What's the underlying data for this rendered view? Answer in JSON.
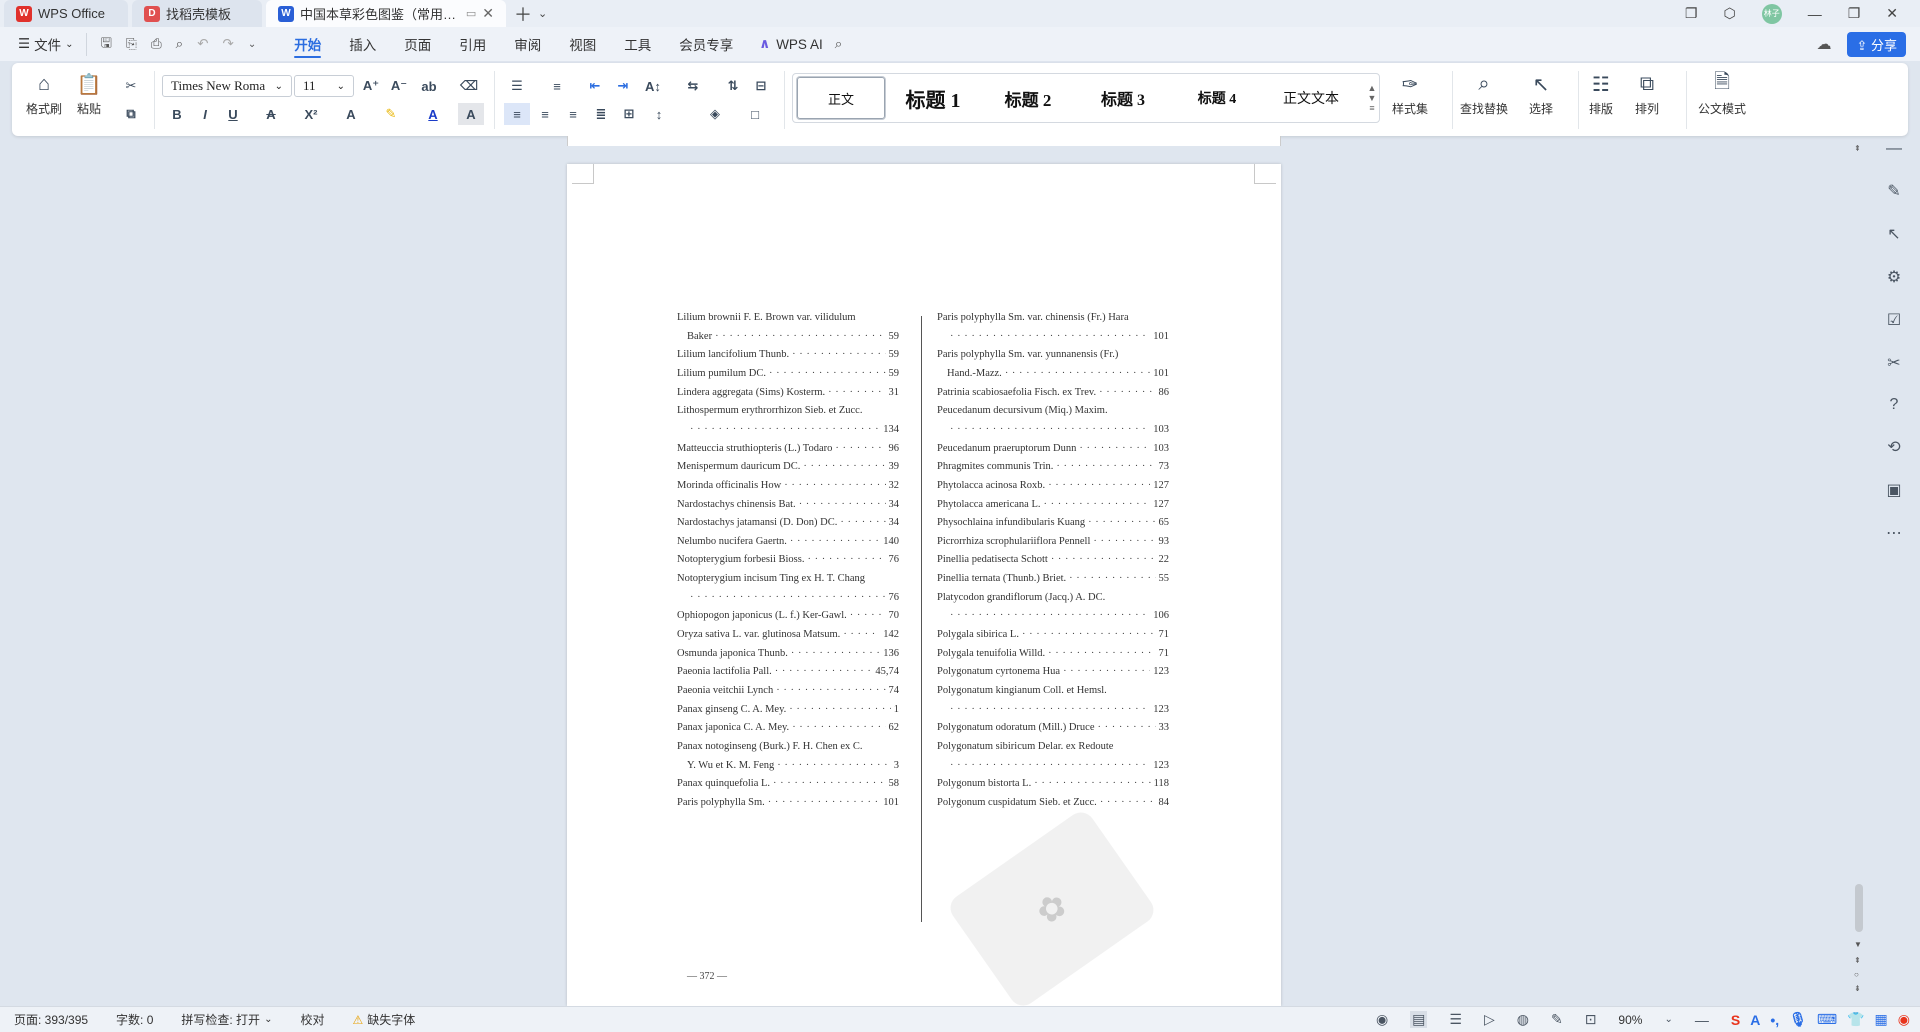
{
  "titlebar": {
    "tabs": [
      {
        "label": "WPS Office",
        "icon": "wps-logo-icon"
      },
      {
        "label": "找稻壳模板",
        "icon": "docer-icon"
      },
      {
        "label": "中国本草彩色图鉴（常用中药篇）",
        "icon": "word-doc-icon"
      }
    ],
    "avatar_text": "林子"
  },
  "menubar": {
    "file_label": "文件",
    "menus": [
      "开始",
      "插入",
      "页面",
      "引用",
      "审阅",
      "视图",
      "工具",
      "会员专享"
    ],
    "active_menu": "开始",
    "wps_ai_label": "WPS AI",
    "share_label": "分享"
  },
  "ribbon": {
    "format_painter": "格式刷",
    "paste": "粘贴",
    "font_name": "Times New Roma",
    "font_size": "11",
    "styles": [
      "正文",
      "标题 1",
      "标题 2",
      "标题 3",
      "标题 4",
      "正文文本"
    ],
    "style_set": "样式集",
    "find_replace": "查找替换",
    "select": "选择",
    "layout": "排版",
    "arrange": "排列",
    "official_mode": "公文模式"
  },
  "document": {
    "left_column": [
      {
        "name": "Lilium brownii F. E. Brown var. vilidulum",
        "page": ""
      },
      {
        "name": "Baker",
        "page": "59",
        "indent": true
      },
      {
        "name": "Lilium lancifolium Thunb.",
        "page": "59"
      },
      {
        "name": "Lilium pumilum DC.",
        "page": "59"
      },
      {
        "name": "Lindera aggregata (Sims) Kosterm.",
        "page": "31"
      },
      {
        "name": "Lithospermum erythrorrhizon Sieb. et Zucc.",
        "page": ""
      },
      {
        "name": "",
        "page": "134",
        "indent": true
      },
      {
        "name": "Matteuccia struthiopteris (L.) Todaro",
        "page": "96"
      },
      {
        "name": "Menispermum dauricum DC.",
        "page": "39"
      },
      {
        "name": "Morinda officinalis How",
        "page": "32"
      },
      {
        "name": "Nardostachys chinensis Bat.",
        "page": "34"
      },
      {
        "name": "Nardostachys jatamansi (D. Don) DC.",
        "page": "34"
      },
      {
        "name": "Nelumbo nucifera Gaertn.",
        "page": "140"
      },
      {
        "name": "Notopterygium forbesii Bioss.",
        "page": "76"
      },
      {
        "name": "Notopterygium incisum Ting ex H. T. Chang",
        "page": ""
      },
      {
        "name": "",
        "page": "76",
        "indent": true
      },
      {
        "name": "Ophiopogon japonicus (L. f.) Ker-Gawl.",
        "page": "70"
      },
      {
        "name": "Oryza sativa L. var. glutinosa Matsum.",
        "page": "142"
      },
      {
        "name": "Osmunda japonica Thunb.",
        "page": "136"
      },
      {
        "name": "Paeonia lactifolia Pall.",
        "page": "45,74"
      },
      {
        "name": "Paeonia veitchii Lynch",
        "page": "74"
      },
      {
        "name": "Panax ginseng C. A. Mey.",
        "page": "1"
      },
      {
        "name": "Panax japonica C. A. Mey.",
        "page": "62"
      },
      {
        "name": "Panax notoginseng (Burk.) F. H. Chen ex C.",
        "page": ""
      },
      {
        "name": "Y. Wu et K. M. Feng",
        "page": "3",
        "indent": true
      },
      {
        "name": "Panax quinquefolia L.",
        "page": "58"
      },
      {
        "name": "Paris polyphylla Sm.",
        "page": "101"
      }
    ],
    "right_column": [
      {
        "name": "Paris polyphylla Sm. var. chinensis (Fr.) Hara",
        "page": ""
      },
      {
        "name": "",
        "page": "101",
        "indent": true
      },
      {
        "name": "Paris polyphylla Sm. var. yunnanensis (Fr.)",
        "page": ""
      },
      {
        "name": "Hand.-Mazz.",
        "page": "101",
        "indent": true
      },
      {
        "name": "Patrinia scabiosaefolia Fisch. ex Trev.",
        "page": "86"
      },
      {
        "name": "Peucedanum decursivum (Miq.) Maxim.",
        "page": ""
      },
      {
        "name": "",
        "page": "103",
        "indent": true
      },
      {
        "name": "Peucedanum praeruptorum Dunn",
        "page": "103"
      },
      {
        "name": "Phragmites communis Trin.",
        "page": "73"
      },
      {
        "name": "Phytolacca acinosa Roxb.",
        "page": "127"
      },
      {
        "name": "Phytolacca americana L.",
        "page": "127"
      },
      {
        "name": "Physochlaina infundibularis Kuang",
        "page": "65"
      },
      {
        "name": "Picrorrhiza scrophulariiflora Pennell",
        "page": "93"
      },
      {
        "name": "Pinellia pedatisecta Schott",
        "page": "22"
      },
      {
        "name": "Pinellia ternata (Thunb.) Briet.",
        "page": "55"
      },
      {
        "name": "Platycodon grandiflorum (Jacq.) A. DC.",
        "page": ""
      },
      {
        "name": "",
        "page": "106",
        "indent": true
      },
      {
        "name": "Polygala sibirica L.",
        "page": "71"
      },
      {
        "name": "Polygala tenuifolia Willd.",
        "page": "71"
      },
      {
        "name": "Polygonatum cyrtonema Hua",
        "page": "123"
      },
      {
        "name": "Polygonatum kingianum Coll. et Hemsl.",
        "page": ""
      },
      {
        "name": "",
        "page": "123",
        "indent": true
      },
      {
        "name": "Polygonatum odoratum (Mill.) Druce",
        "page": "33"
      },
      {
        "name": "Polygonatum sibiricum Delar. ex Redoute",
        "page": ""
      },
      {
        "name": "",
        "page": "123",
        "indent": true
      },
      {
        "name": "Polygonum bistorta L.",
        "page": "118"
      },
      {
        "name": "Polygonum cuspidatum Sieb. et Zucc.",
        "page": "84"
      }
    ],
    "page_number": "— 372 —"
  },
  "statusbar": {
    "page": "页面: 393/395",
    "words": "字数: 0",
    "spellcheck": "拼写检查: 打开",
    "proofread": "校对",
    "missing_font": "缺失字体",
    "zoom": "90%"
  },
  "colors": {
    "accent": "#2b6de0",
    "wps_red": "#e0312c",
    "docer_red": "#e05050",
    "word_blue": "#2a5fd6"
  }
}
